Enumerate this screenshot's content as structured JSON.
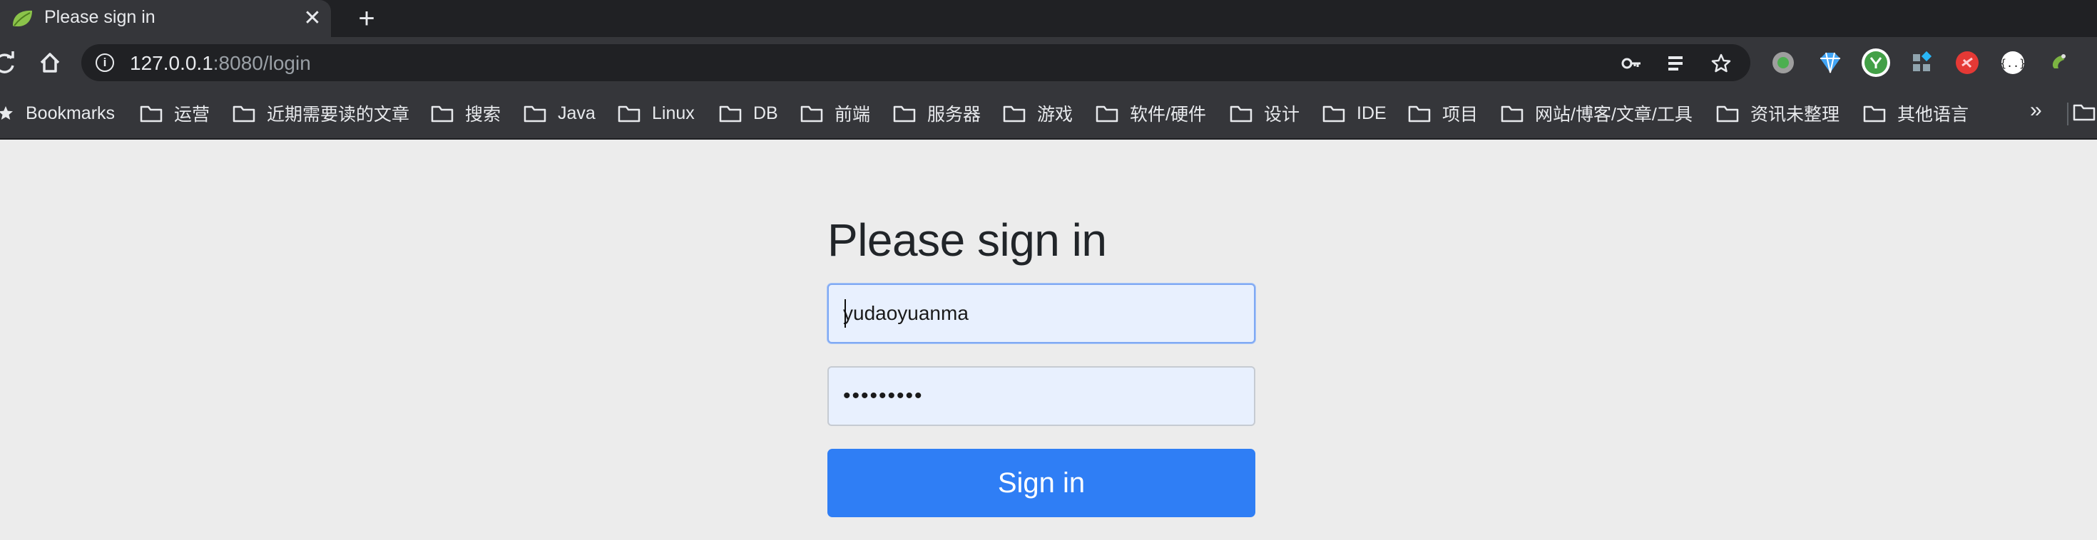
{
  "tab": {
    "title": "Please sign in",
    "close_glyph": "✕"
  },
  "new_tab_glyph": "+",
  "toolbar": {
    "url_host": "127.0.0.1",
    "url_path": ":8080/login"
  },
  "bookmarks": {
    "items": [
      {
        "label": "Bookmarks",
        "icon": "star-icon"
      },
      {
        "label": "运营",
        "icon": "folder-icon"
      },
      {
        "label": "近期需要读的文章",
        "icon": "folder-icon"
      },
      {
        "label": "搜索",
        "icon": "folder-icon"
      },
      {
        "label": "Java",
        "icon": "folder-icon"
      },
      {
        "label": "Linux",
        "icon": "folder-icon"
      },
      {
        "label": "DB",
        "icon": "folder-icon"
      },
      {
        "label": "前端",
        "icon": "folder-icon"
      },
      {
        "label": "服务器",
        "icon": "folder-icon"
      },
      {
        "label": "游戏",
        "icon": "folder-icon"
      },
      {
        "label": "软件/硬件",
        "icon": "folder-icon"
      },
      {
        "label": "设计",
        "icon": "folder-icon"
      },
      {
        "label": "IDE",
        "icon": "folder-icon"
      },
      {
        "label": "项目",
        "icon": "folder-icon"
      },
      {
        "label": "网站/博客/文章/工具",
        "icon": "folder-icon"
      },
      {
        "label": "资讯未整理",
        "icon": "folder-icon"
      },
      {
        "label": "其他语言",
        "icon": "folder-icon"
      }
    ],
    "more_glyph": "»"
  },
  "form": {
    "heading": "Please sign in",
    "username_value": "yudaoyuanma",
    "password_value": "•••••••••",
    "submit_label": "Sign in"
  },
  "colors": {
    "button": "#2f7ef5",
    "autofill": "#e8f0fe",
    "page_bg": "#ececec",
    "chrome_dark": "#202124",
    "chrome_tab": "#35363a"
  }
}
